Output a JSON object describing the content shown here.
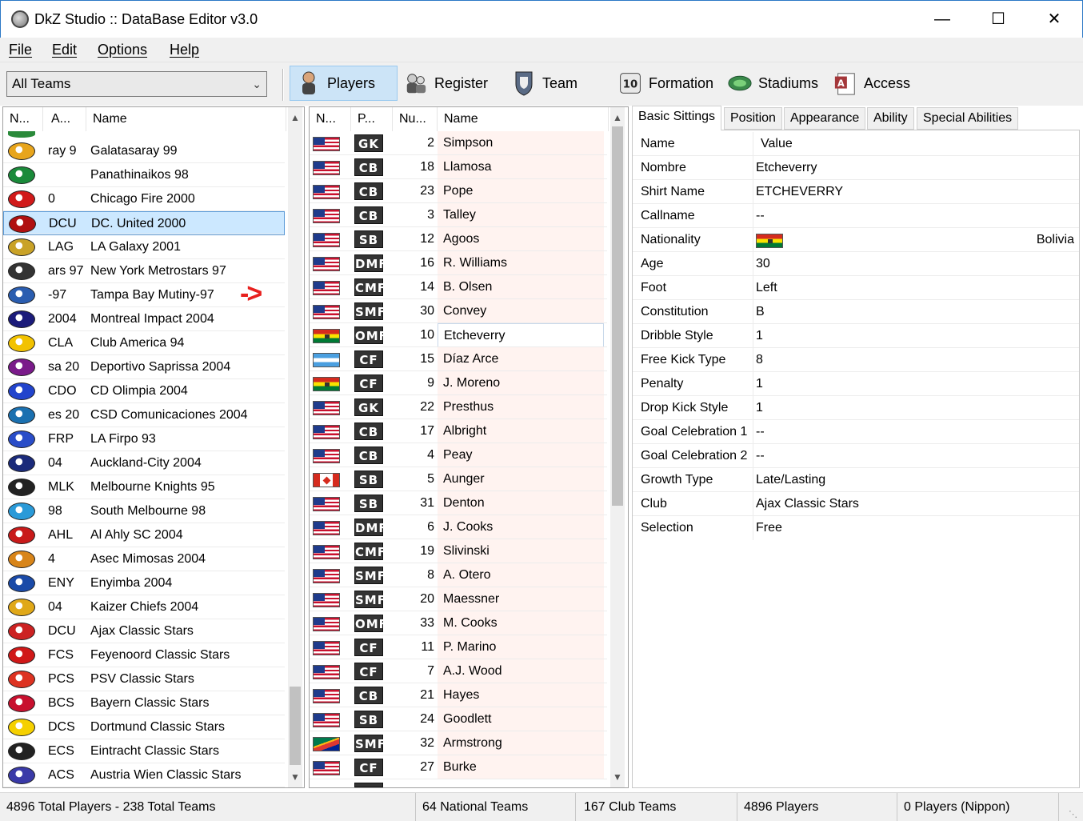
{
  "window": {
    "title": "DkZ Studio :: DataBase Editor v3.0"
  },
  "menu": [
    "File",
    "Edit",
    "Options",
    "Help"
  ],
  "toolbar": {
    "team_filter": "All Teams",
    "buttons": [
      {
        "label": "Players",
        "icon": "player-icon",
        "active": true
      },
      {
        "label": "Register",
        "icon": "register-icon",
        "active": false
      },
      {
        "label": "Team",
        "icon": "team-icon",
        "active": false
      },
      {
        "label": "Formation",
        "icon": "formation-icon",
        "active": false
      },
      {
        "label": "Stadiums",
        "icon": "stadium-icon",
        "active": false
      },
      {
        "label": "Access",
        "icon": "access-icon",
        "active": false
      }
    ]
  },
  "teams": {
    "columns": [
      "N...",
      "A...",
      "Name"
    ],
    "selected_index": 3,
    "rows": [
      {
        "abbr": "ray 9",
        "name": "Galatasaray 99",
        "crest_color": "#e8a51c"
      },
      {
        "abbr": "",
        "name": "Panathinaikos 98",
        "crest_color": "#1a8a3a"
      },
      {
        "abbr": "0",
        "name": "Chicago Fire 2000",
        "crest_color": "#d11a1a"
      },
      {
        "abbr": "DCU",
        "name": "DC. United 2000",
        "crest_color": "#b01010"
      },
      {
        "abbr": "LAG",
        "name": "LA Galaxy 2001",
        "crest_color": "#c9a227"
      },
      {
        "abbr": "ars 97",
        "name": "New York Metrostars 97",
        "crest_color": "#333333"
      },
      {
        "abbr": "-97",
        "name": "Tampa Bay Mutiny-97",
        "crest_color": "#2a5db0"
      },
      {
        "abbr": "2004",
        "name": "Montreal Impact 2004",
        "crest_color": "#1b1b7a"
      },
      {
        "abbr": "CLA",
        "name": "Club America 94",
        "crest_color": "#f2c200"
      },
      {
        "abbr": "sa 20",
        "name": "Deportivo Saprissa 2004",
        "crest_color": "#7a1a8a"
      },
      {
        "abbr": "CDO",
        "name": "CD Olimpia 2004",
        "crest_color": "#2244cc"
      },
      {
        "abbr": "es 20",
        "name": "CSD Comunicaciones 2004",
        "crest_color": "#1a70b0"
      },
      {
        "abbr": "FRP",
        "name": "LA Firpo 93",
        "crest_color": "#2a4dc8"
      },
      {
        "abbr": "04",
        "name": "Auckland-City 2004",
        "crest_color": "#1a2a7a"
      },
      {
        "abbr": "MLK",
        "name": "Melbourne Knights 95",
        "crest_color": "#222222"
      },
      {
        "abbr": "98",
        "name": "South Melbourne 98",
        "crest_color": "#2a9ad8"
      },
      {
        "abbr": "AHL",
        "name": "Al Ahly SC 2004",
        "crest_color": "#c81a1a"
      },
      {
        "abbr": "4",
        "name": "Asec Mimosas 2004",
        "crest_color": "#d8851a"
      },
      {
        "abbr": "ENY",
        "name": "Enyimba 2004",
        "crest_color": "#1a4aa8"
      },
      {
        "abbr": "04",
        "name": "Kaizer Chiefs 2004",
        "crest_color": "#e0a818"
      },
      {
        "abbr": "DCU",
        "name": "Ajax Classic Stars",
        "crest_color": "#cc2222"
      },
      {
        "abbr": "FCS",
        "name": "Feyenoord Classic Stars",
        "crest_color": "#d01818"
      },
      {
        "abbr": "PCS",
        "name": "PSV Classic Stars",
        "crest_color": "#dd3322"
      },
      {
        "abbr": "BCS",
        "name": "Bayern Classic Stars",
        "crest_color": "#c8102e"
      },
      {
        "abbr": "DCS",
        "name": "Dortmund Classic Stars",
        "crest_color": "#f5d000"
      },
      {
        "abbr": "ECS",
        "name": "Eintracht Classic Stars",
        "crest_color": "#222222"
      },
      {
        "abbr": "ACS",
        "name": "Austria Wien Classic Stars",
        "crest_color": "#3a3aa8"
      }
    ]
  },
  "players": {
    "columns": [
      "N...",
      "P...",
      "Nu...",
      "Name"
    ],
    "selected_index": 8,
    "rows": [
      {
        "flag": "usa",
        "pos": "GK",
        "num": "2",
        "name": "Simpson"
      },
      {
        "flag": "usa",
        "pos": "CB",
        "num": "18",
        "name": "Llamosa"
      },
      {
        "flag": "usa",
        "pos": "CB",
        "num": "23",
        "name": "Pope"
      },
      {
        "flag": "usa",
        "pos": "CB",
        "num": "3",
        "name": "Talley"
      },
      {
        "flag": "usa",
        "pos": "SB",
        "num": "12",
        "name": "Agoos"
      },
      {
        "flag": "usa",
        "pos": "DMF",
        "num": "16",
        "name": "R. Williams"
      },
      {
        "flag": "usa",
        "pos": "CMF",
        "num": "14",
        "name": "B. Olsen"
      },
      {
        "flag": "usa",
        "pos": "SMF",
        "num": "30",
        "name": "Convey"
      },
      {
        "flag": "bol",
        "pos": "OMF",
        "num": "10",
        "name": "Etcheverry"
      },
      {
        "flag": "hon",
        "pos": "CF",
        "num": "15",
        "name": "Díaz Arce"
      },
      {
        "flag": "bol",
        "pos": "CF",
        "num": "9",
        "name": "J. Moreno"
      },
      {
        "flag": "usa",
        "pos": "GK",
        "num": "22",
        "name": "Presthus"
      },
      {
        "flag": "usa",
        "pos": "CB",
        "num": "17",
        "name": "Albright"
      },
      {
        "flag": "usa",
        "pos": "CB",
        "num": "4",
        "name": "Peay"
      },
      {
        "flag": "can",
        "pos": "SB",
        "num": "5",
        "name": "Aunger"
      },
      {
        "flag": "usa",
        "pos": "SB",
        "num": "31",
        "name": "Denton"
      },
      {
        "flag": "usa",
        "pos": "DMF",
        "num": "6",
        "name": "J. Cooks"
      },
      {
        "flag": "usa",
        "pos": "CMF",
        "num": "19",
        "name": "Slivinski"
      },
      {
        "flag": "usa",
        "pos": "SMF",
        "num": "8",
        "name": "A. Otero"
      },
      {
        "flag": "usa",
        "pos": "SMF",
        "num": "20",
        "name": "Maessner"
      },
      {
        "flag": "usa",
        "pos": "OMF",
        "num": "33",
        "name": "M. Cooks"
      },
      {
        "flag": "usa",
        "pos": "CF",
        "num": "11",
        "name": "P. Marino"
      },
      {
        "flag": "usa",
        "pos": "CF",
        "num": "7",
        "name": "A.J. Wood"
      },
      {
        "flag": "usa",
        "pos": "CB",
        "num": "21",
        "name": "Hayes"
      },
      {
        "flag": "usa",
        "pos": "SB",
        "num": "24",
        "name": "Goodlett"
      },
      {
        "flag": "rsa",
        "pos": "SMF",
        "num": "32",
        "name": "Armstrong"
      },
      {
        "flag": "usa",
        "pos": "CF",
        "num": "27",
        "name": "Burke"
      }
    ]
  },
  "details": {
    "tabs": [
      "Basic Sittings",
      "Position",
      "Appearance",
      "Ability",
      "Special Abilities"
    ],
    "active_tab": 0,
    "header": {
      "name": "Name",
      "value": "Value"
    },
    "rows": [
      {
        "name": "Nombre",
        "value": "Etcheverry"
      },
      {
        "name": "Shirt Name",
        "value": "ETCHEVERRY"
      },
      {
        "name": "Callname",
        "value": "--"
      },
      {
        "name": "Nationality",
        "value": "Bolivia",
        "flag": "bol"
      },
      {
        "name": "Age",
        "value": "30"
      },
      {
        "name": "Foot",
        "value": "Left"
      },
      {
        "name": "Constitution",
        "value": "B"
      },
      {
        "name": "Dribble Style",
        "value": "1"
      },
      {
        "name": "Free Kick Type",
        "value": "8"
      },
      {
        "name": "Penalty",
        "value": "1"
      },
      {
        "name": "Drop Kick Style",
        "value": "1"
      },
      {
        "name": "Goal Celebration 1",
        "value": "--"
      },
      {
        "name": "Goal Celebration 2",
        "value": "--"
      },
      {
        "name": "Growth Type",
        "value": "Late/Lasting"
      },
      {
        "name": "Club",
        "value": "Ajax Classic Stars"
      },
      {
        "name": "Selection",
        "value": "Free"
      }
    ]
  },
  "status": {
    "totals": "4896 Total Players  -  238 Total Teams",
    "national": "64 National Teams",
    "club": "167 Club Teams",
    "players": "4896 Players",
    "nippon": "0 Players (Nippon)"
  },
  "annotation_arrow": "->"
}
